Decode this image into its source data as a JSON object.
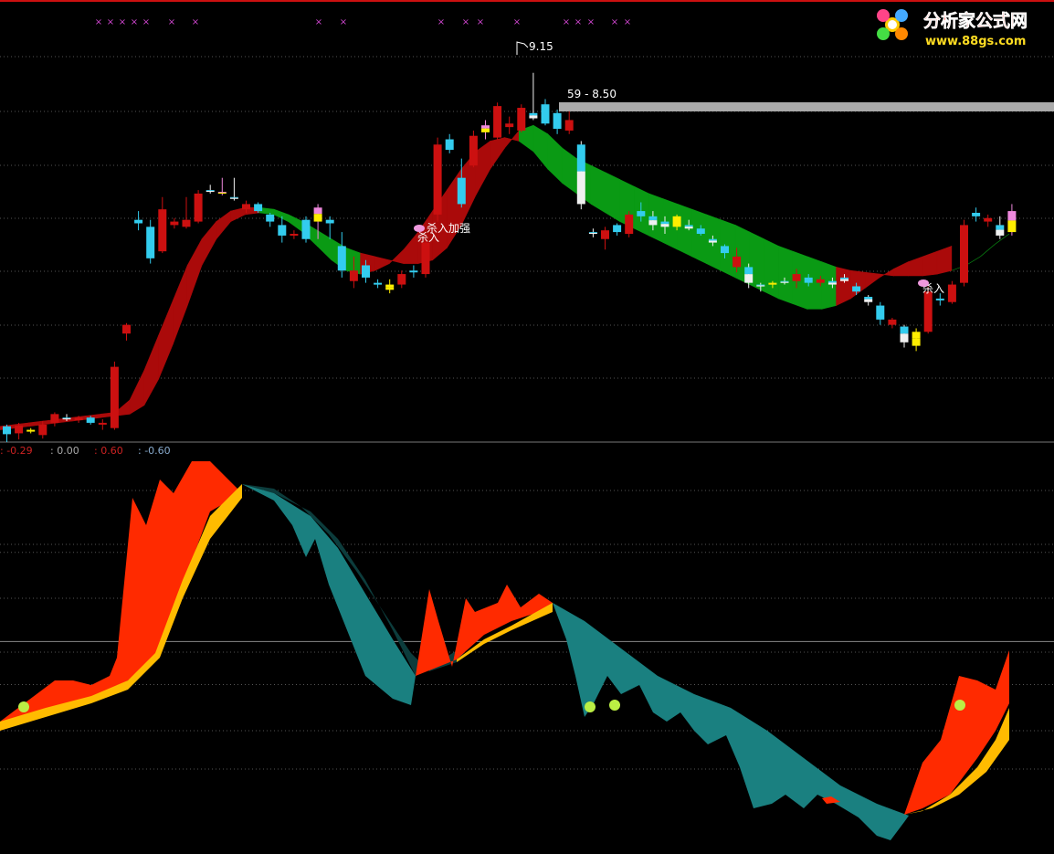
{
  "colors": {
    "bg": "#000000",
    "up": "#cc1010",
    "down": "#33ccee",
    "white": "#f0f0f0",
    "yellow": "#ffee00",
    "pink": "#ee88dd",
    "ribbon_red": "#aa0a0a",
    "ribbon_green": "#0a9a14",
    "osc_red": "#ff2a00",
    "osc_orange": "#ffbb00",
    "osc_teal": "#1a8080",
    "osc_dark": "#0c3c3c",
    "grid": "#555555",
    "grid_solid": "#888888",
    "marker": "#cc44cc",
    "label": "#ffffff",
    "bar": "#aaaaaa",
    "apple": "#bbee44"
  },
  "logo": {
    "title": "分析家公式网",
    "url": "www.88gs.com"
  },
  "chart_data": [
    {
      "type": "candlestick",
      "panel": "price",
      "ylim": [
        6.94,
        9.44
      ],
      "bars": [
        {
          "o": 6.985,
          "h": 7.04,
          "l": 6.94,
          "c": 7.03,
          "color": "down"
        },
        {
          "o": 6.99,
          "h": 7.05,
          "l": 6.955,
          "c": 7.035,
          "color": "up"
        },
        {
          "o": 7.01,
          "h": 7.02,
          "l": 6.99,
          "c": 7.005,
          "color": "yellow"
        },
        {
          "o": 6.98,
          "h": 7.06,
          "l": 6.96,
          "c": 7.04,
          "color": "up"
        },
        {
          "o": 7.05,
          "h": 7.11,
          "l": 7.03,
          "c": 7.1,
          "color": "up"
        },
        {
          "o": 7.07,
          "h": 7.1,
          "l": 7.06,
          "c": 7.08,
          "color": "white"
        },
        {
          "o": 7.065,
          "h": 7.09,
          "l": 7.05,
          "c": 7.08,
          "color": "up"
        },
        {
          "o": 7.08,
          "h": 7.09,
          "l": 7.04,
          "c": 7.05,
          "color": "down"
        },
        {
          "o": 7.05,
          "h": 7.07,
          "l": 7.01,
          "c": 7.05,
          "color": "up"
        },
        {
          "o": 7.02,
          "h": 7.4,
          "l": 7.01,
          "c": 7.37,
          "color": "up"
        },
        {
          "o": 7.56,
          "h": 7.62,
          "l": 7.52,
          "c": 7.61,
          "color": "up"
        },
        {
          "o": 8.19,
          "h": 8.26,
          "l": 8.15,
          "c": 8.21,
          "color": "down"
        },
        {
          "o": 8.17,
          "h": 8.21,
          "l": 7.96,
          "c": 7.99,
          "color": "down"
        },
        {
          "o": 8.03,
          "h": 8.34,
          "l": 8.02,
          "c": 8.27,
          "color": "up"
        },
        {
          "o": 8.18,
          "h": 8.22,
          "l": 8.16,
          "c": 8.2,
          "color": "up"
        },
        {
          "o": 8.17,
          "h": 8.34,
          "l": 8.16,
          "c": 8.21,
          "color": "up"
        },
        {
          "o": 8.2,
          "h": 8.38,
          "l": 8.19,
          "c": 8.36,
          "color": "up"
        },
        {
          "o": 8.38,
          "h": 8.41,
          "l": 8.36,
          "c": 8.38,
          "color": "white"
        },
        {
          "o": 8.36,
          "h": 8.45,
          "l": 8.35,
          "c": 8.37,
          "color": "pink"
        },
        {
          "o": 8.33,
          "h": 8.45,
          "l": 8.32,
          "c": 8.34,
          "color": "white"
        },
        {
          "o": 8.3,
          "h": 8.32,
          "l": 8.25,
          "c": 8.27,
          "color": "up"
        },
        {
          "o": 8.3,
          "h": 8.31,
          "l": 8.25,
          "c": 8.26,
          "color": "down"
        },
        {
          "o": 8.24,
          "h": 8.25,
          "l": 8.17,
          "c": 8.2,
          "color": "down"
        },
        {
          "o": 8.18,
          "h": 8.23,
          "l": 8.08,
          "c": 8.12,
          "color": "down"
        },
        {
          "o": 8.13,
          "h": 8.15,
          "l": 8.1,
          "c": 8.12,
          "color": "up"
        },
        {
          "o": 8.21,
          "h": 8.23,
          "l": 8.08,
          "c": 8.1,
          "color": "down"
        },
        {
          "o": 8.2,
          "h": 8.3,
          "l": 8.1,
          "c": 8.28,
          "color": "pink"
        },
        {
          "o": 8.19,
          "h": 8.23,
          "l": 8.1,
          "c": 8.21,
          "color": "down"
        },
        {
          "o": 8.06,
          "h": 8.14,
          "l": 7.88,
          "c": 7.92,
          "color": "down"
        },
        {
          "o": 7.92,
          "h": 8.0,
          "l": 7.82,
          "c": 7.86,
          "color": "up"
        },
        {
          "o": 7.95,
          "h": 7.98,
          "l": 7.85,
          "c": 7.88,
          "color": "down"
        },
        {
          "o": 7.85,
          "h": 7.87,
          "l": 7.82,
          "c": 7.84,
          "color": "down"
        },
        {
          "o": 7.81,
          "h": 7.87,
          "l": 7.79,
          "c": 7.84,
          "color": "yellow"
        },
        {
          "o": 7.84,
          "h": 7.92,
          "l": 7.82,
          "c": 7.9,
          "color": "up"
        },
        {
          "o": 7.92,
          "h": 7.95,
          "l": 7.88,
          "c": 7.91,
          "color": "down"
        },
        {
          "o": 7.9,
          "h": 8.11,
          "l": 7.88,
          "c": 8.08,
          "color": "up"
        },
        {
          "o": 8.24,
          "h": 8.68,
          "l": 8.2,
          "c": 8.64,
          "color": "up"
        },
        {
          "o": 8.67,
          "h": 8.7,
          "l": 8.59,
          "c": 8.61,
          "color": "down"
        },
        {
          "o": 8.45,
          "h": 8.56,
          "l": 8.28,
          "c": 8.3,
          "color": "down"
        },
        {
          "o": 8.52,
          "h": 8.72,
          "l": 8.51,
          "c": 8.69,
          "color": "up"
        },
        {
          "o": 8.71,
          "h": 8.78,
          "l": 8.67,
          "c": 8.75,
          "color": "pink"
        },
        {
          "o": 8.68,
          "h": 8.88,
          "l": 8.67,
          "c": 8.86,
          "color": "up"
        },
        {
          "o": 8.74,
          "h": 8.8,
          "l": 8.7,
          "c": 8.76,
          "color": "up"
        },
        {
          "o": 8.72,
          "h": 8.87,
          "l": 8.71,
          "c": 8.85,
          "color": "up"
        },
        {
          "o": 8.79,
          "h": 9.05,
          "l": 8.78,
          "c": 8.82,
          "color": "white"
        },
        {
          "o": 8.76,
          "h": 8.9,
          "l": 8.75,
          "c": 8.87,
          "color": "down"
        },
        {
          "o": 8.82,
          "h": 8.84,
          "l": 8.7,
          "c": 8.73,
          "color": "down"
        },
        {
          "o": 8.72,
          "h": 8.83,
          "l": 8.7,
          "c": 8.78,
          "color": "up"
        },
        {
          "o": 8.64,
          "h": 8.66,
          "l": 8.27,
          "c": 8.3,
          "color": "white"
        },
        {
          "o": 8.14,
          "h": 8.16,
          "l": 8.11,
          "c": 8.13,
          "color": "white"
        },
        {
          "o": 8.1,
          "h": 8.17,
          "l": 8.04,
          "c": 8.15,
          "color": "up"
        },
        {
          "o": 8.18,
          "h": 8.19,
          "l": 8.12,
          "c": 8.14,
          "color": "down"
        },
        {
          "o": 8.13,
          "h": 8.26,
          "l": 8.11,
          "c": 8.24,
          "color": "up"
        },
        {
          "o": 8.26,
          "h": 8.31,
          "l": 8.2,
          "c": 8.23,
          "color": "down"
        },
        {
          "o": 8.23,
          "h": 8.26,
          "l": 8.15,
          "c": 8.18,
          "color": "white"
        },
        {
          "o": 8.2,
          "h": 8.23,
          "l": 8.13,
          "c": 8.17,
          "color": "white"
        },
        {
          "o": 8.17,
          "h": 8.24,
          "l": 8.15,
          "c": 8.23,
          "color": "yellow"
        },
        {
          "o": 8.18,
          "h": 8.21,
          "l": 8.15,
          "c": 8.16,
          "color": "white"
        },
        {
          "o": 8.16,
          "h": 8.18,
          "l": 8.12,
          "c": 8.13,
          "color": "down"
        },
        {
          "o": 8.1,
          "h": 8.12,
          "l": 8.06,
          "c": 8.08,
          "color": "white"
        },
        {
          "o": 8.06,
          "h": 8.07,
          "l": 7.99,
          "c": 8.02,
          "color": "down"
        },
        {
          "o": 8.0,
          "h": 8.05,
          "l": 7.91,
          "c": 7.94,
          "color": "up"
        },
        {
          "o": 7.94,
          "h": 7.96,
          "l": 7.82,
          "c": 7.85,
          "color": "white"
        },
        {
          "o": 7.84,
          "h": 7.85,
          "l": 7.8,
          "c": 7.83,
          "color": "white"
        },
        {
          "o": 7.84,
          "h": 7.86,
          "l": 7.82,
          "c": 7.85,
          "color": "yellow"
        },
        {
          "o": 7.86,
          "h": 7.88,
          "l": 7.84,
          "c": 7.86,
          "color": "white"
        },
        {
          "o": 7.86,
          "h": 7.93,
          "l": 7.82,
          "c": 7.9,
          "color": "up"
        },
        {
          "o": 7.88,
          "h": 7.9,
          "l": 7.83,
          "c": 7.85,
          "color": "down"
        },
        {
          "o": 7.87,
          "h": 7.89,
          "l": 7.83,
          "c": 7.85,
          "color": "up"
        },
        {
          "o": 7.86,
          "h": 7.88,
          "l": 7.82,
          "c": 7.84,
          "color": "white"
        },
        {
          "o": 7.86,
          "h": 7.9,
          "l": 7.85,
          "c": 7.88,
          "color": "white"
        },
        {
          "o": 7.83,
          "h": 7.85,
          "l": 7.78,
          "c": 7.8,
          "color": "down"
        },
        {
          "o": 7.77,
          "h": 7.78,
          "l": 7.72,
          "c": 7.74,
          "color": "white"
        },
        {
          "o": 7.72,
          "h": 7.74,
          "l": 7.61,
          "c": 7.64,
          "color": "down"
        },
        {
          "o": 7.64,
          "h": 7.65,
          "l": 7.59,
          "c": 7.61,
          "color": "up"
        },
        {
          "o": 7.6,
          "h": 7.61,
          "l": 7.48,
          "c": 7.51,
          "color": "white"
        },
        {
          "o": 7.57,
          "h": 7.59,
          "l": 7.46,
          "c": 7.49,
          "color": "yellow"
        },
        {
          "o": 7.57,
          "h": 7.83,
          "l": 7.56,
          "c": 7.8,
          "color": "up"
        },
        {
          "o": 7.75,
          "h": 7.79,
          "l": 7.72,
          "c": 7.76,
          "color": "down"
        },
        {
          "o": 7.74,
          "h": 7.86,
          "l": 7.73,
          "c": 7.84,
          "color": "up"
        },
        {
          "o": 7.85,
          "h": 8.21,
          "l": 7.83,
          "c": 8.18,
          "color": "up"
        },
        {
          "o": 8.25,
          "h": 8.28,
          "l": 8.2,
          "c": 8.23,
          "color": "down"
        },
        {
          "o": 8.2,
          "h": 8.24,
          "l": 8.17,
          "c": 8.22,
          "color": "up"
        },
        {
          "o": 8.18,
          "h": 8.23,
          "l": 8.1,
          "c": 8.12,
          "color": "white"
        },
        {
          "o": 8.14,
          "h": 8.3,
          "l": 8.12,
          "c": 8.26,
          "color": "pink"
        }
      ],
      "ribbon": {
        "upper": [
          7.03,
          7.04,
          7.05,
          7.06,
          7.07,
          7.08,
          7.09,
          7.1,
          7.11,
          7.18,
          7.35,
          7.55,
          7.75,
          7.95,
          8.1,
          8.2,
          8.26,
          8.28,
          8.28,
          8.27,
          8.24,
          8.2,
          8.15,
          8.1,
          8.05,
          8.02,
          8.0,
          7.98,
          7.96,
          7.96,
          7.98,
          8.05,
          8.18,
          8.35,
          8.5,
          8.62,
          8.72,
          8.75,
          8.7,
          8.62,
          8.56,
          8.52,
          8.48,
          8.44,
          8.4,
          8.36,
          8.33,
          8.3,
          8.27,
          8.24,
          8.21,
          8.18,
          8.14,
          8.1,
          8.06,
          8.03,
          8.0,
          7.97,
          7.94,
          7.92,
          7.91,
          7.9,
          7.89,
          7.89,
          7.89,
          7.9,
          7.92,
          7.95,
          8.0,
          8.07,
          8.13
        ],
        "lower": [
          7.01,
          7.02,
          7.03,
          7.04,
          7.05,
          7.06,
          7.07,
          7.08,
          7.09,
          7.1,
          7.15,
          7.3,
          7.5,
          7.72,
          7.95,
          8.1,
          8.2,
          8.24,
          8.25,
          8.24,
          8.2,
          8.14,
          8.06,
          7.98,
          7.92,
          7.9,
          7.92,
          7.96,
          8.04,
          8.14,
          8.26,
          8.38,
          8.5,
          8.6,
          8.66,
          8.68,
          8.66,
          8.6,
          8.5,
          8.42,
          8.36,
          8.3,
          8.25,
          8.2,
          8.16,
          8.12,
          8.08,
          8.04,
          8.0,
          7.96,
          7.92,
          7.88,
          7.84,
          7.8,
          7.76,
          7.73,
          7.7,
          7.7,
          7.72,
          7.76,
          7.82,
          7.88,
          7.93,
          7.97,
          8.0,
          8.03,
          8.06
        ]
      },
      "labels": [
        {
          "text": "9.15"
        },
        {
          "text": "59 - 8.50"
        },
        {
          "text": "杀入加强"
        },
        {
          "text": "杀入"
        },
        {
          "text": "杀入"
        }
      ],
      "markers": [
        {
          "symbol": "×"
        },
        {
          "symbol": "×"
        }
      ]
    },
    {
      "type": "area",
      "panel": "oscillator",
      "ylim": [
        -1.43,
        1.33
      ],
      "legend": [
        {
          "text": ": -0.29",
          "color": "#cc2222"
        },
        {
          "text": ": 0.00",
          "color": "#aaaaaa"
        },
        {
          "text": ": 0.60",
          "color": "#cc2222"
        },
        {
          "text": ": -0.60",
          "color": "#88aacc"
        }
      ],
      "reference_lines": [
        -0.29,
        0.0,
        0.6,
        -0.6
      ]
    }
  ]
}
